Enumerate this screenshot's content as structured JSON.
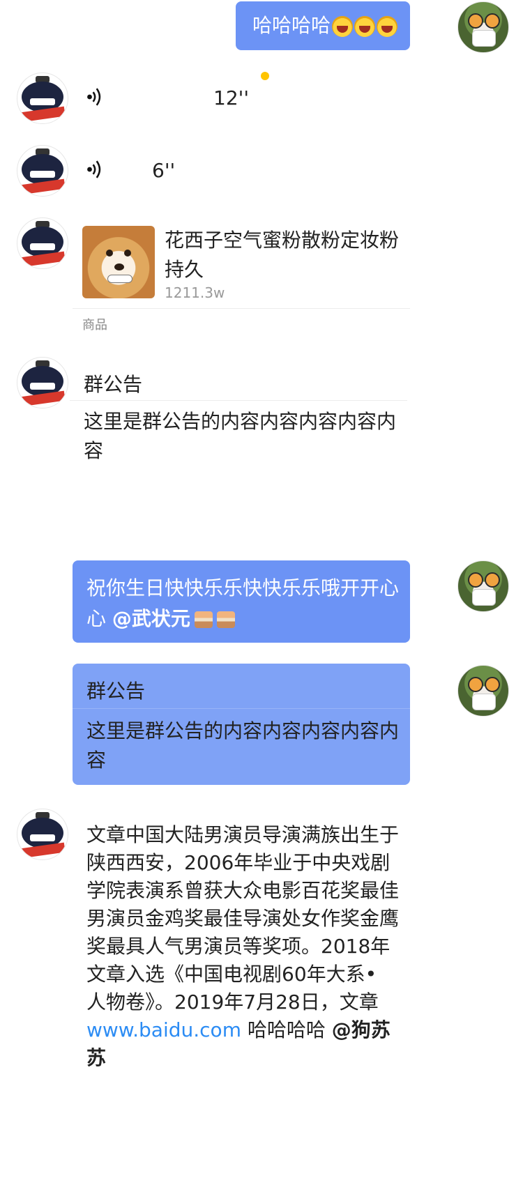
{
  "messages": {
    "m1": {
      "text": "哈哈哈哈",
      "emoji": [
        "laugh-emoji",
        "laugh-emoji",
        "laugh-emoji"
      ]
    },
    "voice1": {
      "duration": "12''"
    },
    "voice2": {
      "duration": "6''"
    },
    "product": {
      "title": "花西子空气蜜粉散粉定妆粉持久",
      "count": "1211.3w",
      "label": "商品"
    },
    "notice1": {
      "title": "群公告",
      "body": "这里是群公告的内容内容内容内容内容"
    },
    "birthday": {
      "text": "祝你生日快快乐乐快快乐乐哦开开心心",
      "mention": "@武状元"
    },
    "notice2": {
      "title": "群公告",
      "body": "这里是群公告的内容内容内容内容内容"
    },
    "article": {
      "text": "文章中国大陆男演员导演满族出生于陕西西安，2006年毕业于中央戏剧学院表演系曾获大众电影百花奖最佳男演员金鸡奖最佳导演处女作奖金鹰奖最具人气男演员等奖项。2018年文章入选《中国电视剧60年大系• 人物卷》。2019年7月28日，文章",
      "link": "www.baidu.com",
      "after": " 哈哈哈哈",
      "mention": "@狗苏苏"
    }
  },
  "colors": {
    "bubble_blue": "#6c93f5",
    "link": "#2c8cf4",
    "unread": "#ffc400"
  }
}
